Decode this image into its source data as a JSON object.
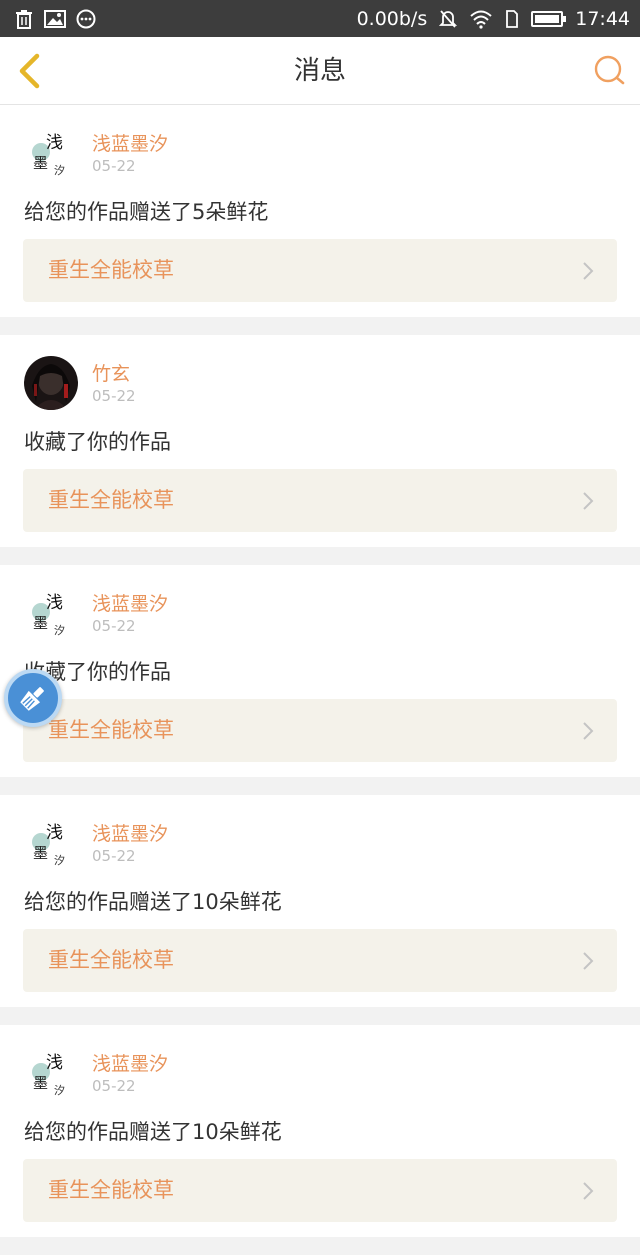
{
  "status_bar": {
    "network_speed": "0.00b/s",
    "time": "17:44",
    "left_icons": [
      "trash-icon",
      "image-icon",
      "more-circle-icon"
    ],
    "right_icons": [
      "mute-icon",
      "wifi-icon",
      "sim-icon",
      "battery-icon"
    ]
  },
  "header": {
    "title": "消息",
    "back_icon": "chevron-left-icon",
    "search_icon": "search-icon"
  },
  "colors": {
    "accent": "#e8935a",
    "back_arrow": "#e5b62a",
    "card_link_bg": "#f4f2ea",
    "float_button": "#4a90d6"
  },
  "messages": [
    {
      "username": "浅蓝墨汐",
      "date": "05-22",
      "text": "给您的作品赠送了5朵鲜花",
      "work_title": "重生全能校草",
      "avatar": "ink-calligraphy-avatar"
    },
    {
      "username": "竹玄",
      "date": "05-22",
      "text": "收藏了你的作品",
      "work_title": "重生全能校草",
      "avatar": "dark-portrait-avatar"
    },
    {
      "username": "浅蓝墨汐",
      "date": "05-22",
      "text": "收藏了你的作品",
      "work_title": "重生全能校草",
      "avatar": "ink-calligraphy-avatar"
    },
    {
      "username": "浅蓝墨汐",
      "date": "05-22",
      "text": "给您的作品赠送了10朵鲜花",
      "work_title": "重生全能校草",
      "avatar": "ink-calligraphy-avatar"
    },
    {
      "username": "浅蓝墨汐",
      "date": "05-22",
      "text": "给您的作品赠送了10朵鲜花",
      "work_title": "重生全能校草",
      "avatar": "ink-calligraphy-avatar"
    }
  ],
  "floating_button": {
    "icon": "broom-icon"
  }
}
